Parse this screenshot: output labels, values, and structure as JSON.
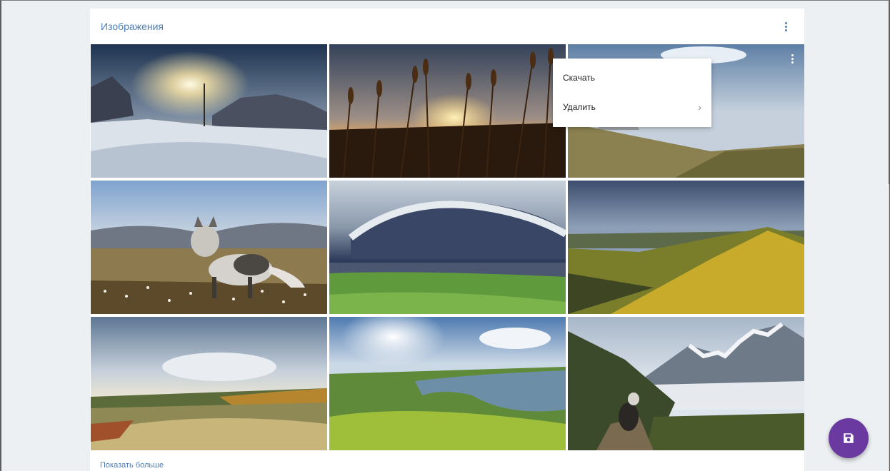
{
  "card": {
    "title": "Изображения",
    "more_icon": "more-vert-icon"
  },
  "gallery": {
    "items": [
      {
        "subject": "winter-sunset-snow"
      },
      {
        "subject": "reeds-sunset"
      },
      {
        "subject": "cliffs-valley"
      },
      {
        "subject": "arctic-fox"
      },
      {
        "subject": "storm-cloud-river"
      },
      {
        "subject": "golden-hills"
      },
      {
        "subject": "autumn-prairie"
      },
      {
        "subject": "river-bend-sunburst"
      },
      {
        "subject": "dog-mountains"
      }
    ]
  },
  "context_menu": {
    "download_label": "Скачать",
    "delete_label": "Удалить",
    "submenu_icon": "chevron-right-icon"
  },
  "footer": {
    "show_more_label": "Показать больше"
  },
  "fab": {
    "icon": "save-icon",
    "color": "#6a3aa0"
  },
  "colors": {
    "accent": "#4d80b8"
  }
}
